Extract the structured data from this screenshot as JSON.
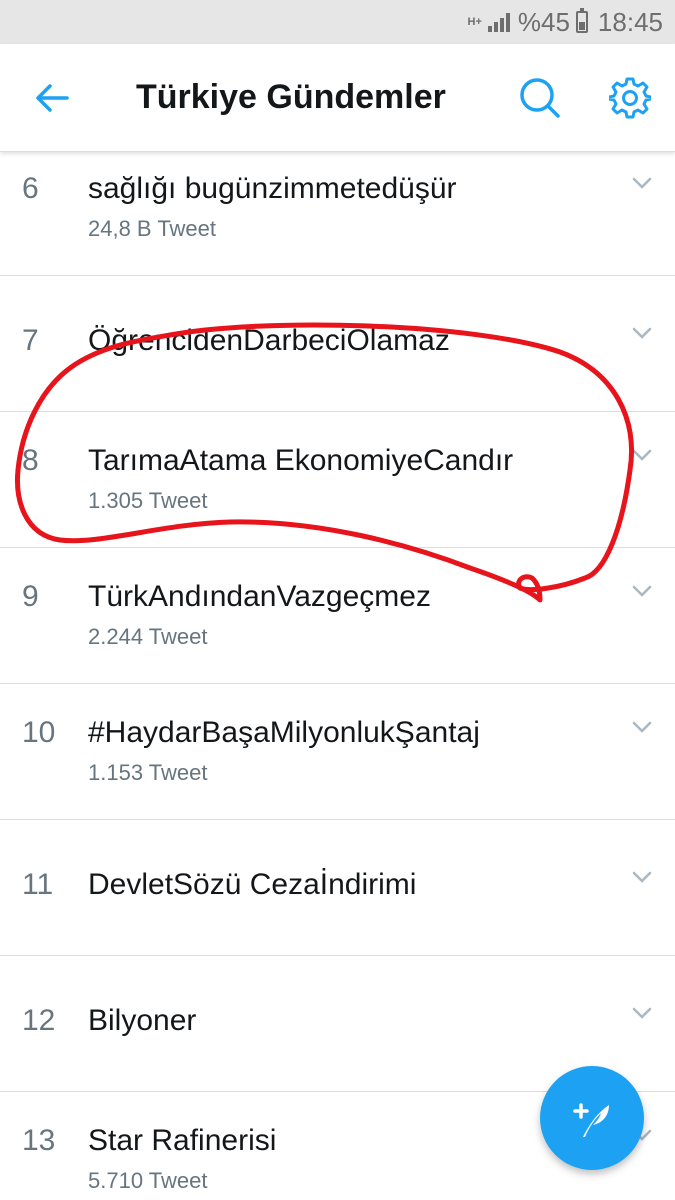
{
  "status_bar": {
    "network": "H+",
    "battery": "%45",
    "time": "18:45"
  },
  "header": {
    "title": "Türkiye Gündemler",
    "back_icon": "arrow-left-icon",
    "search_icon": "search-icon",
    "settings_icon": "gear-icon"
  },
  "colors": {
    "accent": "#1da1f2",
    "annotation": "#e8141b"
  },
  "trends": [
    {
      "rank": "6",
      "name": "sağlığı bugünzimmetedüşür",
      "count": "24,8 B Tweet"
    },
    {
      "rank": "7",
      "name": "ÖğrencidenDarbeciOlamaz",
      "count": ""
    },
    {
      "rank": "8",
      "name": "TarımaAtama EkonomiyeCandır",
      "count": "1.305 Tweet"
    },
    {
      "rank": "9",
      "name": "TürkAndındanVazgeçmez",
      "count": "2.244 Tweet"
    },
    {
      "rank": "10",
      "name": "#HaydarBaşaMilyonlukŞantaj",
      "count": "1.153 Tweet"
    },
    {
      "rank": "11",
      "name": "DevletSözü Cezaİndirimi",
      "count": ""
    },
    {
      "rank": "12",
      "name": "Bilyoner",
      "count": ""
    },
    {
      "rank": "13",
      "name": "Star Rafinerisi",
      "count": "5.710 Tweet"
    }
  ],
  "fab": {
    "icon": "compose-tweet-icon"
  }
}
